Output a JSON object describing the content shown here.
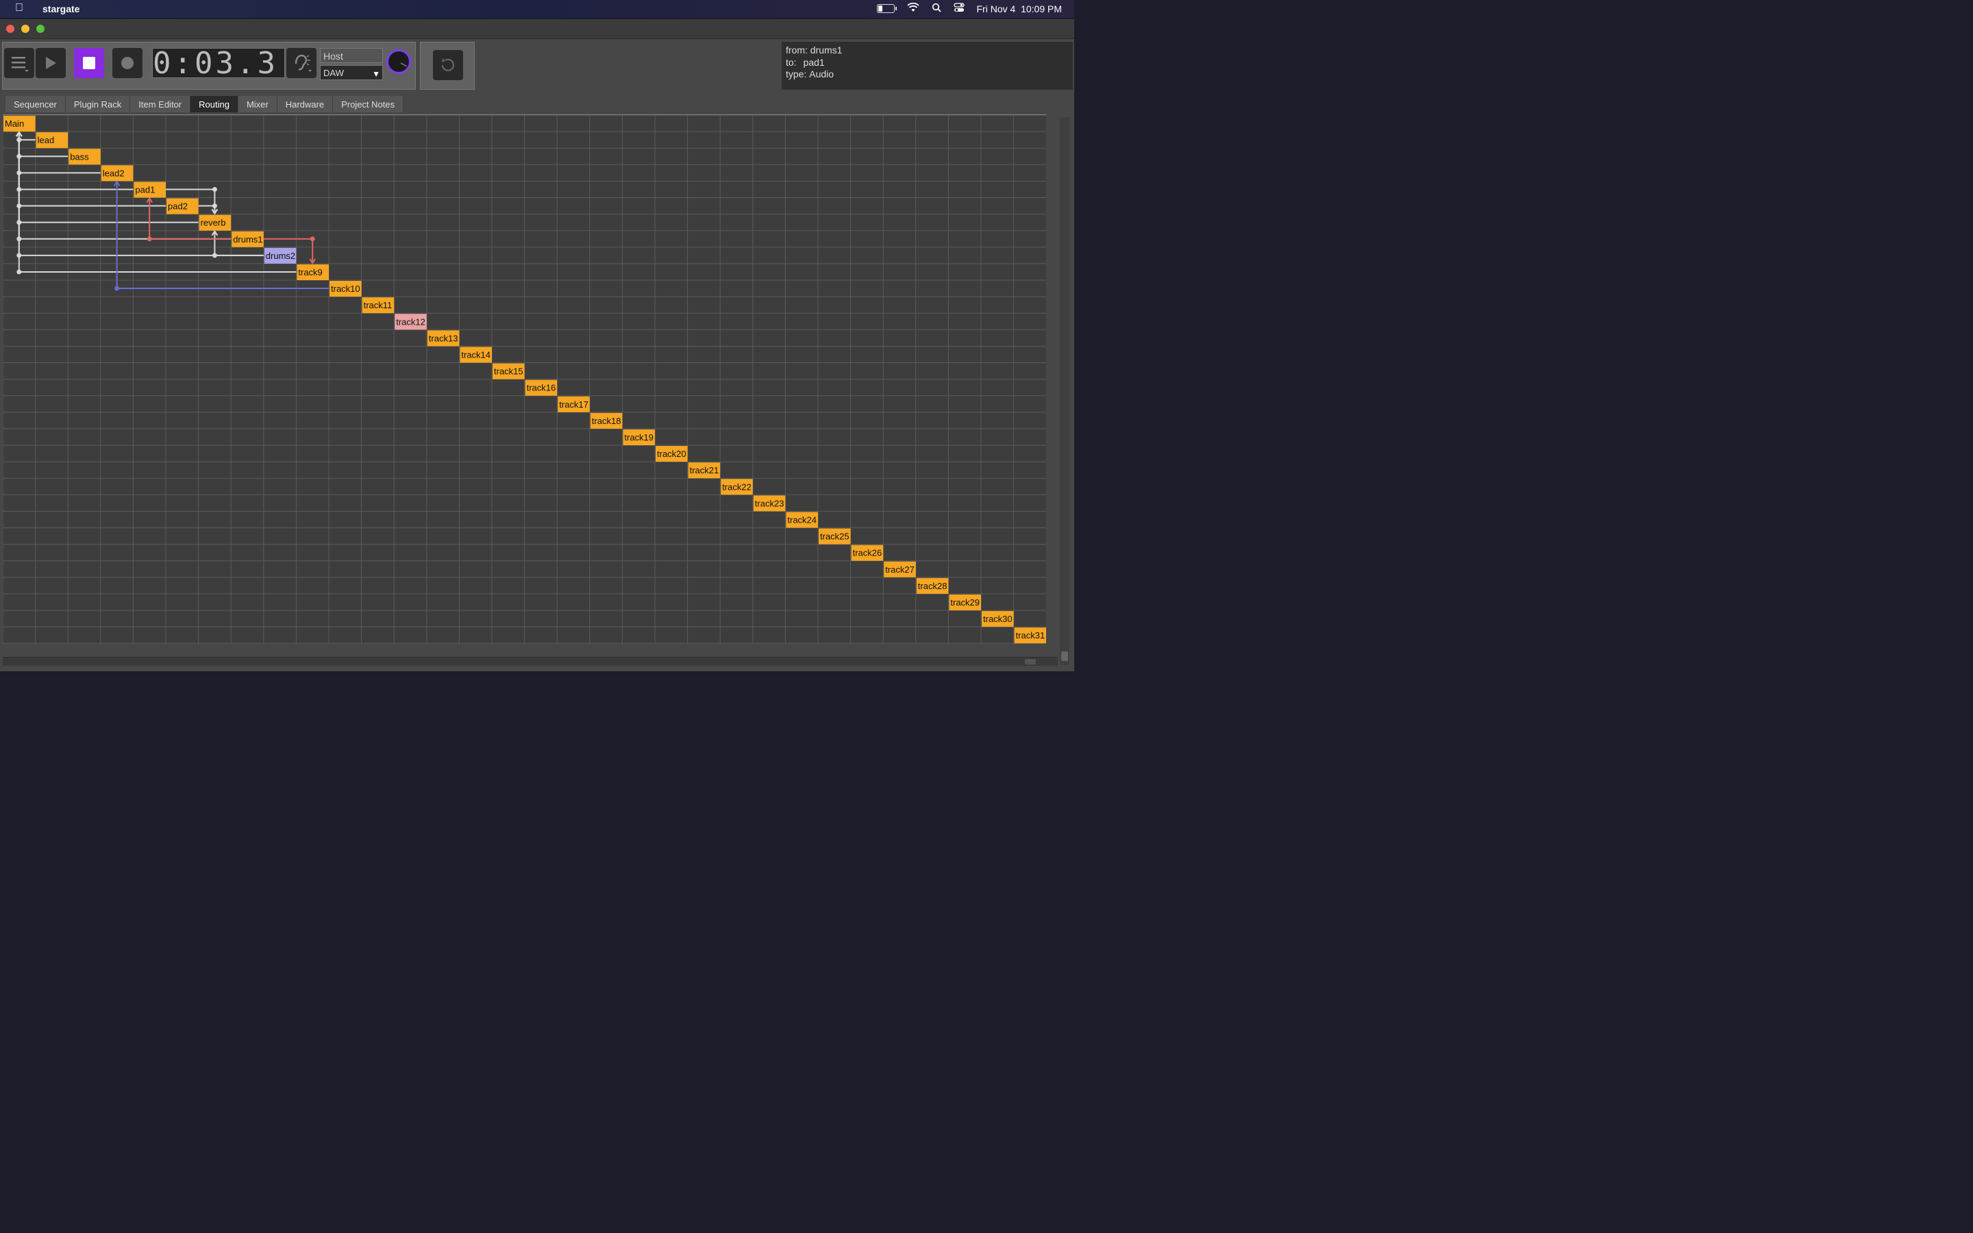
{
  "menubar": {
    "app_name": "stargate",
    "datetime": "Fri Nov 4  10:09 PM"
  },
  "transport": {
    "time_display": "0:03.3",
    "host_label": "Host",
    "host_value": "DAW"
  },
  "info": {
    "from_label": "from:",
    "from_value": "drums1",
    "to_label": "to:",
    "to_value": "pad1",
    "type_label": "type:",
    "type_value": "Audio"
  },
  "tabs": [
    "Sequencer",
    "Plugin Rack",
    "Item Editor",
    "Routing",
    "Mixer",
    "Hardware",
    "Project Notes"
  ],
  "active_tab": "Routing",
  "tracks": [
    {
      "name": "Main",
      "color": "#f5a623"
    },
    {
      "name": "lead",
      "color": "#f5a623"
    },
    {
      "name": "bass",
      "color": "#f5a623"
    },
    {
      "name": "lead2",
      "color": "#f5a623"
    },
    {
      "name": "pad1",
      "color": "#f5a623"
    },
    {
      "name": "pad2",
      "color": "#f5a623"
    },
    {
      "name": "reverb",
      "color": "#f5a623"
    },
    {
      "name": "drums1",
      "color": "#f5a623"
    },
    {
      "name": "drums2",
      "color": "#a7a5e6"
    },
    {
      "name": "track9",
      "color": "#f5a623"
    },
    {
      "name": "track10",
      "color": "#f5a623"
    },
    {
      "name": "track11",
      "color": "#f5a623"
    },
    {
      "name": "track12",
      "color": "#e9a3a3"
    },
    {
      "name": "track13",
      "color": "#f5a623"
    },
    {
      "name": "track14",
      "color": "#f5a623"
    },
    {
      "name": "track15",
      "color": "#f5a623"
    },
    {
      "name": "track16",
      "color": "#f5a623"
    },
    {
      "name": "track17",
      "color": "#f5a623"
    },
    {
      "name": "track18",
      "color": "#f5a623"
    },
    {
      "name": "track19",
      "color": "#f5a623"
    },
    {
      "name": "track20",
      "color": "#f5a623"
    },
    {
      "name": "track21",
      "color": "#f5a623"
    },
    {
      "name": "track22",
      "color": "#f5a623"
    },
    {
      "name": "track23",
      "color": "#f5a623"
    },
    {
      "name": "track24",
      "color": "#f5a623"
    },
    {
      "name": "track25",
      "color": "#f5a623"
    },
    {
      "name": "track26",
      "color": "#f5a623"
    },
    {
      "name": "track27",
      "color": "#f5a623"
    },
    {
      "name": "track28",
      "color": "#f5a623"
    },
    {
      "name": "track29",
      "color": "#f5a623"
    },
    {
      "name": "track30",
      "color": "#f5a623"
    },
    {
      "name": "track31",
      "color": "#f5a623"
    }
  ],
  "routes": [
    {
      "from": 1,
      "to": 0,
      "color": "#d8d8d8"
    },
    {
      "from": 2,
      "to": 0,
      "color": "#d8d8d8"
    },
    {
      "from": 3,
      "to": 0,
      "color": "#d8d8d8"
    },
    {
      "from": 4,
      "to": 0,
      "color": "#d8d8d8"
    },
    {
      "from": 5,
      "to": 0,
      "color": "#d8d8d8"
    },
    {
      "from": 6,
      "to": 0,
      "color": "#d8d8d8"
    },
    {
      "from": 7,
      "to": 0,
      "color": "#d8d8d8"
    },
    {
      "from": 8,
      "to": 0,
      "color": "#d8d8d8"
    },
    {
      "from": 9,
      "to": 0,
      "color": "#d8d8d8"
    },
    {
      "from": 4,
      "to": 6,
      "color": "#d8d8d8"
    },
    {
      "from": 5,
      "to": 6,
      "color": "#d8d8d8"
    },
    {
      "from": 8,
      "to": 6,
      "color": "#d8d8d8"
    },
    {
      "from": 7,
      "to": 4,
      "color": "#e06666"
    },
    {
      "from": 7,
      "to": 9,
      "color": "#e06666"
    },
    {
      "from": 10,
      "to": 3,
      "color": "#6b6bd6"
    }
  ]
}
